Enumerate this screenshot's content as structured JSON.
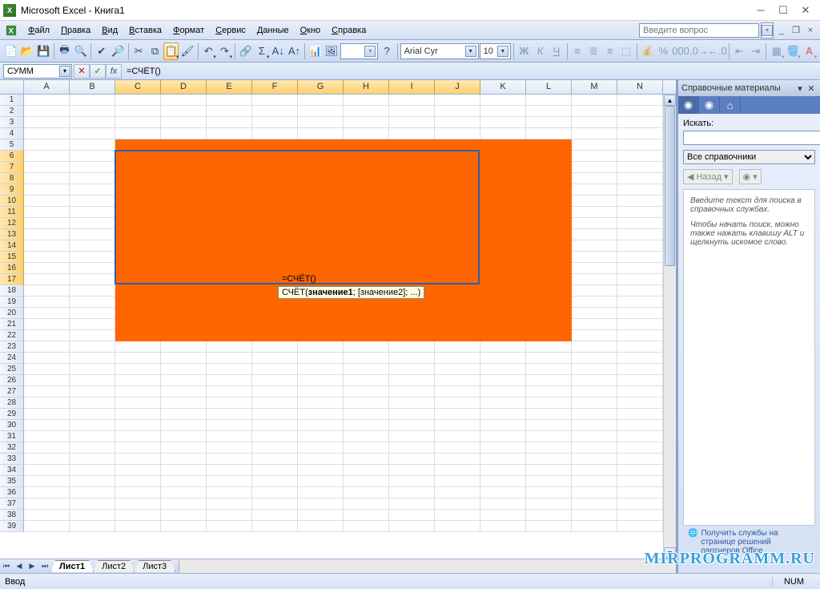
{
  "title": "Microsoft Excel - Книга1",
  "help_placeholder": "Введите вопрос",
  "menu": [
    "Файл",
    "Правка",
    "Вид",
    "Вставка",
    "Формат",
    "Сервис",
    "Данные",
    "Окно",
    "Справка"
  ],
  "menu_keys": [
    "Ф",
    "П",
    "В",
    "В",
    "Ф",
    "С",
    "Д",
    "О",
    "С"
  ],
  "font_name": "Arial Cyr",
  "font_size": "10",
  "name_box": "СУММ",
  "formula": "=СЧЁТ()",
  "tooltip_fn": "СЧЁТ",
  "tooltip_args": "значение1",
  "tooltip_rest": "; [значение2]; ...)",
  "columns": [
    "A",
    "B",
    "C",
    "D",
    "E",
    "F",
    "G",
    "H",
    "I",
    "J",
    "K",
    "L",
    "M",
    "N"
  ],
  "col_widths": {
    "default": 57
  },
  "rows": 39,
  "selected_rows_start": 6,
  "selected_rows_end": 17,
  "selected_cols_start": "C",
  "selected_cols_end": "J",
  "orange_rows": [
    5,
    22
  ],
  "orange_cols": [
    "C",
    "L"
  ],
  "active_cell_text": "=СЧЁТ()",
  "sheet_tabs": [
    "Лист1",
    "Лист2",
    "Лист3"
  ],
  "active_tab": 0,
  "status_text": "Ввод",
  "status_num": "NUM",
  "task_pane": {
    "title": "Справочные материалы",
    "search_label": "Искать:",
    "dropdown": "Все справочники",
    "back": "Назад",
    "info1": "Введите текст для поиска в справочных службах.",
    "info2": "Чтобы начать поиск, можно также нажать клавишу ALT и щелкнуть искомое слово.",
    "footer": "Получить службы на странице решений партнеров Office"
  },
  "watermark": "MIRPROGRAMM.RU"
}
